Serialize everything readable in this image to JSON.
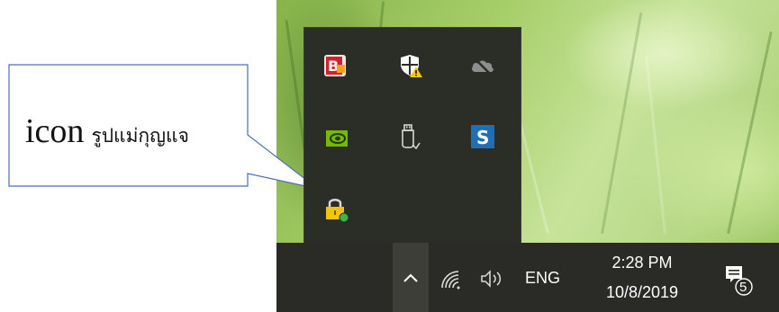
{
  "callout": {
    "label_prefix": "icon",
    "label_thai": "รูปแม่กุญแจ"
  },
  "tray_popup": {
    "icons": [
      "bitdefender-icon",
      "windows-security-warning-icon",
      "onedrive-offline-icon",
      "nvidia-icon",
      "usb-safely-remove-icon",
      "s-app-icon",
      "lock-green-icon"
    ]
  },
  "taskbar": {
    "language": "ENG",
    "time": "2:28 PM",
    "date": "10/8/2019",
    "notification_count": "5"
  },
  "colors": {
    "taskbar_bg": "#2a2b26",
    "popup_bg": "#2b2d27",
    "callout_border": "#4a6fb5"
  }
}
